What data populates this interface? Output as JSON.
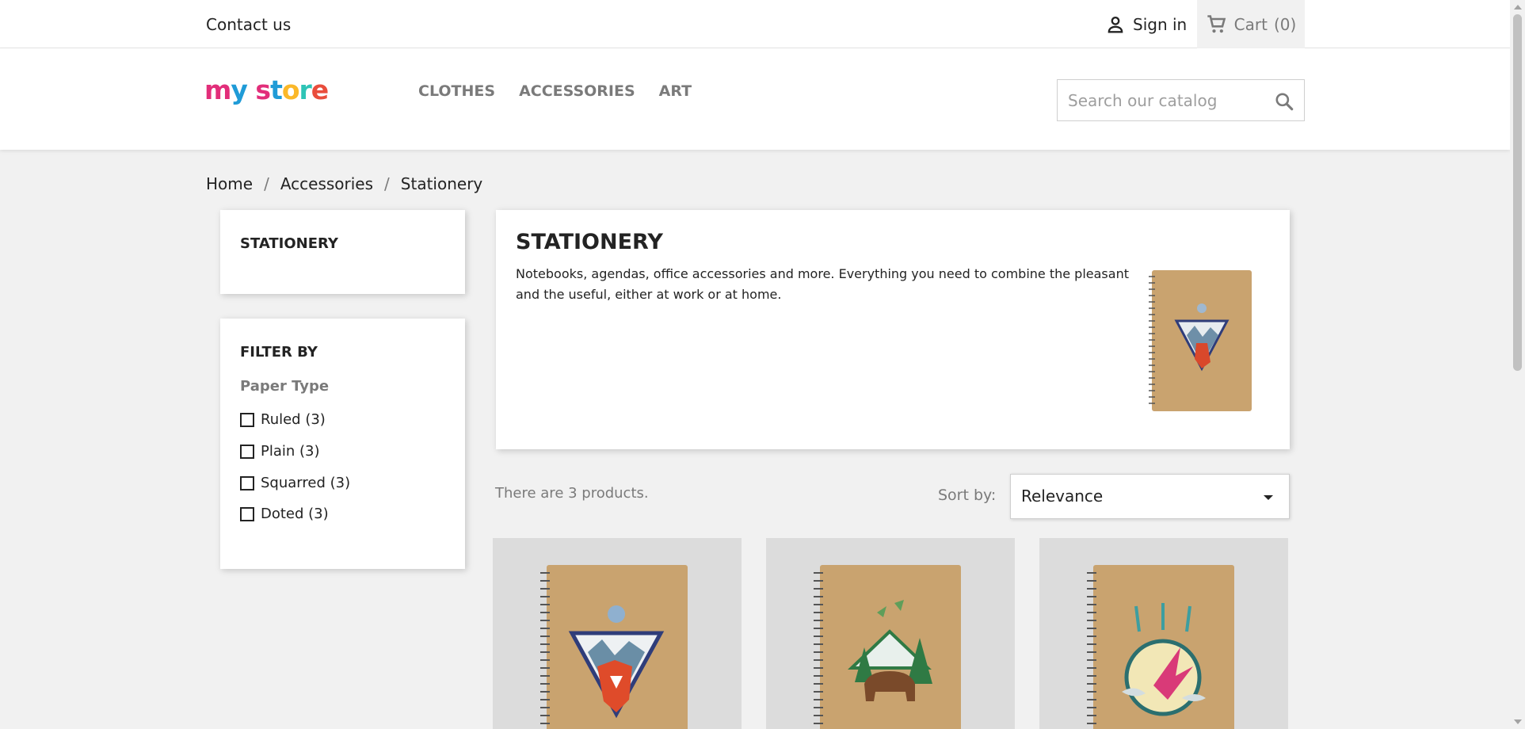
{
  "topbar": {
    "contact_label": "Contact us",
    "signin_label": "Sign in",
    "cart_label": "Cart",
    "cart_count": "(0)",
    "signin_icon": "user-icon",
    "cart_icon": "shopping-cart-icon"
  },
  "header": {
    "logo_letters": [
      "m",
      "y",
      " ",
      "s",
      "t",
      "o",
      "r",
      "e"
    ],
    "logo_colors": [
      "#e22e7a",
      "#1f9bd7",
      "#fff",
      "#e22e7a",
      "#1f9bd7",
      "#fbb829",
      "#2ec4b6",
      "#e94d3c"
    ],
    "nav": [
      "CLOTHES",
      "ACCESSORIES",
      "ART"
    ],
    "search_placeholder": "Search our catalog",
    "search_icon": "search-icon"
  },
  "breadcrumb": [
    "Home",
    "Accessories",
    "Stationery"
  ],
  "sidebar": {
    "category_title": "STATIONERY",
    "filter_title": "FILTER BY",
    "facet_title": "Paper Type",
    "facets": [
      "Ruled (3)",
      "Plain (3)",
      "Squarred (3)",
      "Doted (3)"
    ]
  },
  "category": {
    "title": "STATIONERY",
    "description": "Notebooks, agendas, office accessories and more. Everything you need to combine the pleasant and the useful, either at work or at home."
  },
  "listing": {
    "count_text": "There are 3 products.",
    "sort_label": "Sort by:",
    "sort_value": "Relevance"
  },
  "products": [
    {
      "image": "notebook-fox-icon"
    },
    {
      "image": "notebook-bear-icon"
    },
    {
      "image": "notebook-hummingbird-icon"
    }
  ],
  "colors": {
    "kraft": "#c9a36f",
    "accent": "#24b9d7"
  }
}
